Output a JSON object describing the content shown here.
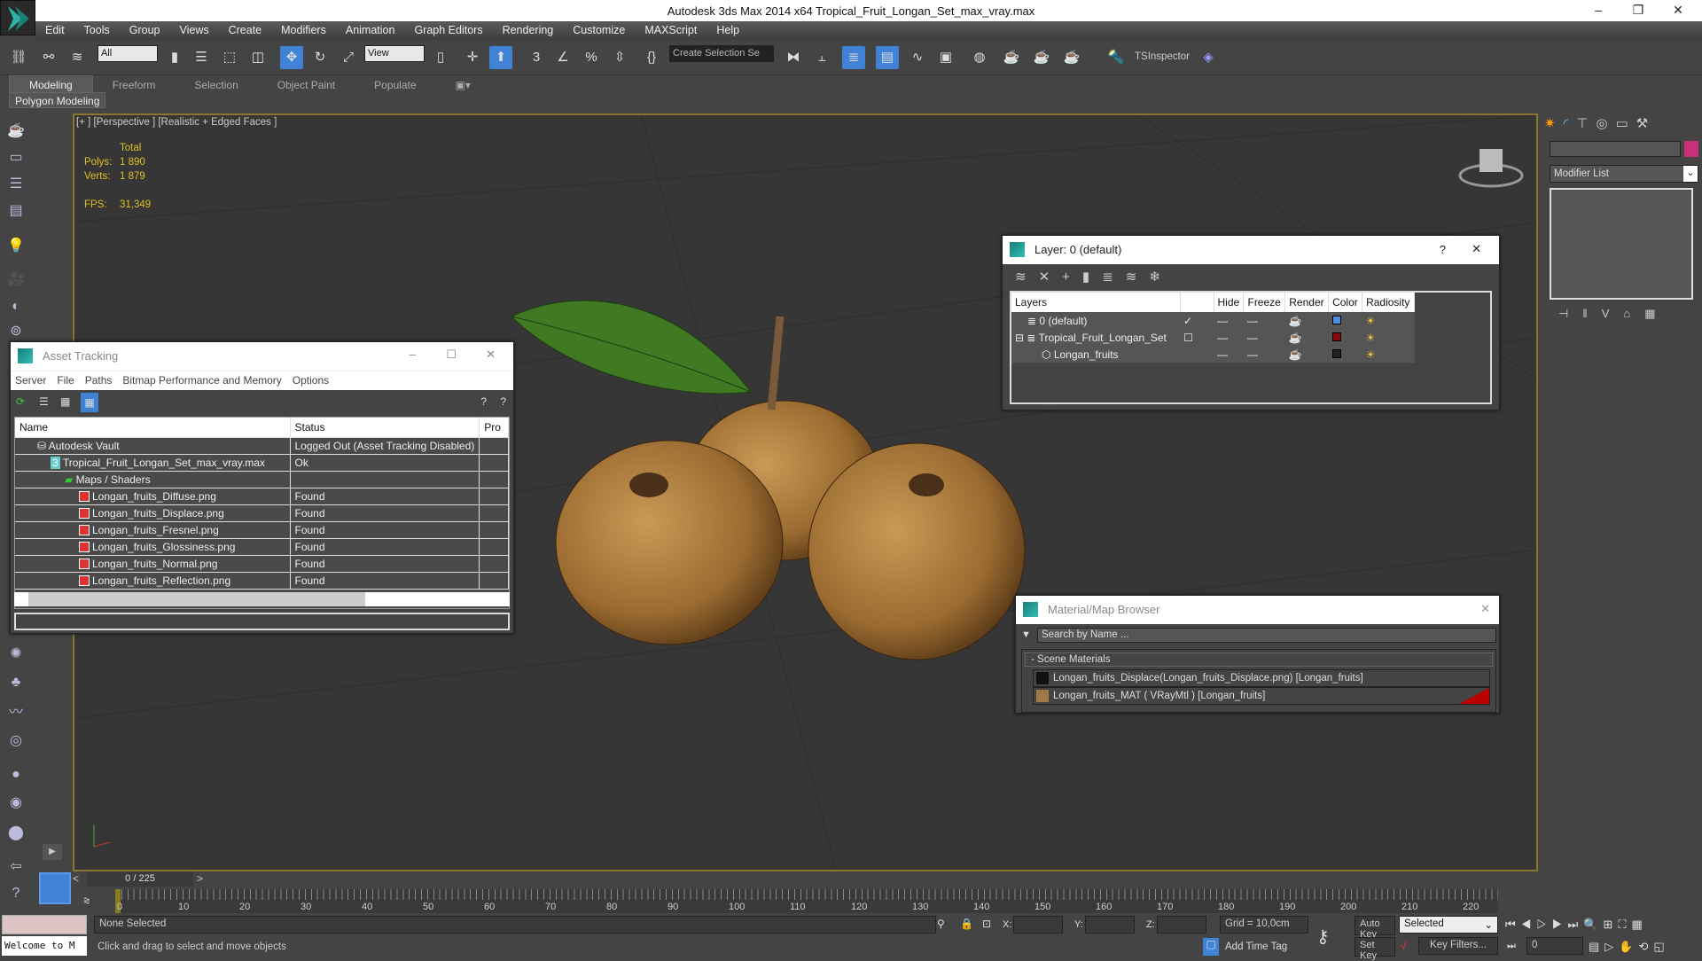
{
  "window": {
    "title": "Autodesk 3ds Max  2014 x64     Tropical_Fruit_Longan_Set_max_vray.max",
    "min": "–",
    "max": "❐",
    "close": "✕"
  },
  "menu": [
    "Edit",
    "Tools",
    "Group",
    "Views",
    "Create",
    "Modifiers",
    "Animation",
    "Graph Editors",
    "Rendering",
    "Customize",
    "MAXScript",
    "Help"
  ],
  "toolbar": {
    "filter": "All",
    "ref_coord": "View",
    "selection_set": "Create Selection Se",
    "plugin": "TSInspector"
  },
  "ribbon": {
    "tabs": [
      "Modeling",
      "Freeform",
      "Selection",
      "Object Paint",
      "Populate"
    ],
    "active": "Modeling",
    "panel": "Polygon Modeling"
  },
  "viewport": {
    "label": "[+ ] [Perspective ] [Realistic + Edged Faces ]",
    "stats": {
      "total": "Total",
      "polys_label": "Polys:",
      "polys": "1 890",
      "verts_label": "Verts:",
      "verts": "1 879",
      "fps_label": "FPS:",
      "fps": "31,349"
    }
  },
  "asset_tracking": {
    "title": "Asset Tracking",
    "menu": [
      "Server",
      "File",
      "Paths",
      "Bitmap Performance and Memory",
      "Options"
    ],
    "columns": [
      "Name",
      "Status",
      "Pro"
    ],
    "rows": [
      {
        "name": "Autodesk Vault",
        "status": "Logged Out (Asset Tracking Disabled)",
        "level": 1,
        "icon": "vault-icon"
      },
      {
        "name": "Tropical_Fruit_Longan_Set_max_vray.max",
        "status": "Ok",
        "level": 2,
        "icon": "max-file-icon"
      },
      {
        "name": "Maps / Shaders",
        "status": "",
        "level": 3,
        "icon": "maps-icon"
      },
      {
        "name": "Longan_fruits_Diffuse.png",
        "status": "Found",
        "level": 4,
        "icon": "png-icon"
      },
      {
        "name": "Longan_fruits_Displace.png",
        "status": "Found",
        "level": 4,
        "icon": "png-icon"
      },
      {
        "name": "Longan_fruits_Fresnel.png",
        "status": "Found",
        "level": 4,
        "icon": "png-icon"
      },
      {
        "name": "Longan_fruits_Glossiness.png",
        "status": "Found",
        "level": 4,
        "icon": "png-icon"
      },
      {
        "name": "Longan_fruits_Normal.png",
        "status": "Found",
        "level": 4,
        "icon": "png-icon"
      },
      {
        "name": "Longan_fruits_Reflection.png",
        "status": "Found",
        "level": 4,
        "icon": "png-icon"
      }
    ]
  },
  "layer_dialog": {
    "title": "Layer: 0 (default)",
    "help": "?",
    "columns": [
      "Layers",
      "",
      "Hide",
      "Freeze",
      "Render",
      "Color",
      "Radiosity"
    ],
    "rows": [
      {
        "name": "0 (default)",
        "current": "✓",
        "color": "#4a8ee0"
      },
      {
        "name": "Tropical_Fruit_Longan_Set",
        "current": "☐",
        "color": "#8b0a0a"
      },
      {
        "name": "Longan_fruits",
        "current": "",
        "color": "#222222"
      }
    ]
  },
  "material_browser": {
    "title": "Material/Map Browser",
    "search_placeholder": "Search by Name ...",
    "group": "- Scene Materials",
    "items": [
      "Longan_fruits_Displace(Longan_fruits_Displace.png) [Longan_fruits]",
      "Longan_fruits_MAT  ( VRayMtl )  [Longan_fruits]"
    ]
  },
  "command_panel": {
    "modifier_list": "Modifier List",
    "object_color": "#c8307a"
  },
  "timeline": {
    "frame": "0 / 225",
    "ticks": [
      0,
      10,
      20,
      30,
      40,
      50,
      60,
      70,
      80,
      90,
      100,
      110,
      120,
      130,
      140,
      150,
      160,
      170,
      180,
      190,
      200,
      210,
      220
    ]
  },
  "status": {
    "selection": "None Selected",
    "prompt": "Click and drag to select and move objects",
    "script": "Welcome to M",
    "x_label": "X:",
    "y_label": "Y:",
    "z_label": "Z:",
    "grid": "Grid = 10,0cm",
    "add_time_tag": "Add Time Tag",
    "auto_key": "Auto Key",
    "set_key": "Set Key",
    "key_mode": "Selected",
    "key_filters": "Key Filters...",
    "current_frame": "0"
  }
}
